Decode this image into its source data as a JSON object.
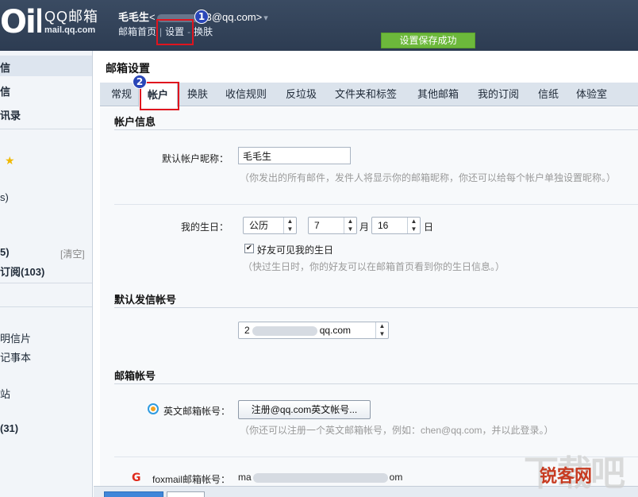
{
  "header": {
    "logo_mark": "Oil",
    "logo_title": "QQ邮箱",
    "logo_sub": "mail.qq.com",
    "user_name": "毛毛生",
    "user_email_prefix": "<",
    "user_email_suffix": "3@qq.com>",
    "user_caret": "▾",
    "links": [
      "邮箱首页",
      "设置",
      "换肤"
    ],
    "link_sep": "|",
    "link_dash": "-",
    "save_toast": "设置保存成功"
  },
  "annotations": {
    "step1": "1",
    "step2": "2"
  },
  "sidebar": {
    "items": [
      {
        "text": "信"
      },
      {
        "text": "信"
      },
      {
        "text": "讯录"
      },
      {
        "text": ""
      },
      {
        "text": "★"
      },
      {
        "text": "s)"
      },
      {
        "text": "5)"
      },
      {
        "text": "[清空]"
      },
      {
        "text": "订阅(103)"
      },
      {
        "text": ""
      },
      {
        "text": "明信片"
      },
      {
        "text": "记事本"
      },
      {
        "text": ""
      },
      {
        "text": "站"
      },
      {
        "text": ""
      },
      {
        "text": "(31)"
      }
    ]
  },
  "main": {
    "page_title": "邮箱设置",
    "tabs": [
      "常规",
      "帐户",
      "换肤",
      "收信规则",
      "反垃圾",
      "文件夹和标签",
      "其他邮箱",
      "我的订阅",
      "信纸",
      "体验室"
    ],
    "account_info": {
      "section_title": "帐户信息",
      "nickname_label": "默认帐户昵称：",
      "nickname_value": "毛毛生",
      "nickname_hint": "（你发出的所有邮件，发件人将显示你的邮箱昵称，你还可以给每个帐户单独设置昵称。）",
      "birthday_label": "我的生日：",
      "calendar_type": "公历",
      "month": "7",
      "month_unit": "月",
      "day": "16",
      "day_unit": "日",
      "birthday_checkbox_label": "好友可见我的生日",
      "birthday_checkbox_checked": "✔",
      "birthday_hint": "（快过生日时，你的好友可以在邮箱首页看到你的生日信息。）"
    },
    "default_sender": {
      "section_title": "默认发信帐号",
      "sender_prefix": "2",
      "sender_suffix": "qq.com"
    },
    "mailbox_accounts": {
      "section_title": "邮箱帐号",
      "english_label": "英文邮箱帐号：",
      "english_button": "注册@qq.com英文帐号...",
      "english_hint": "（你还可以注册一个英文邮箱帐号，例如：chen@qq.com，并以此登录。）",
      "foxmail_icon_text": "G",
      "foxmail_label": "foxmail邮箱帐号：",
      "foxmail_prefix": "ma",
      "foxmail_suffix": "om"
    }
  },
  "watermark": {
    "big": "下载吧",
    "small": "锐客网"
  },
  "colors": {
    "header": "#2d3c52",
    "toast": "#6cb83b",
    "annotation": "#e0141e",
    "annotation_badge": "#2a46b8"
  }
}
